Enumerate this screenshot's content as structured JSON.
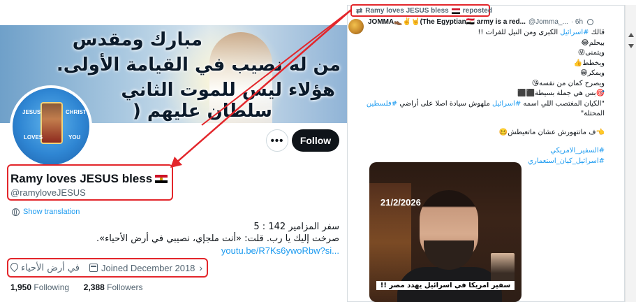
{
  "profile": {
    "banner_lines": [
      "مبارك ومقدس",
      "من له نصيب في القيامة الأولى.",
      "هؤلاء ليس للموت الثاني",
      "سلطان عليهم ("
    ],
    "avatar_text": {
      "left": "JESUS",
      "right": "CHRIST",
      "bottom_left": "LOVES",
      "bottom_right": "YOU"
    },
    "more_label": "•••",
    "follow_label": "Follow",
    "display_name": "Ramy loves JESUS bless",
    "handle": "@ramyloveJESUS",
    "show_translation": "Show translation",
    "bio": {
      "line1": "سفر المزامير 142 : 5",
      "line2": "صرخت إليك يا رب. قلت: «أنت ملجإي، نصيبي في أرض الأحياء».",
      "link": "youtu.be/R7Ks6ywoRbw?si..."
    },
    "location": "في أرض الأحياء",
    "joined": "Joined December 2018",
    "following_count": "1,950",
    "following_label": "Following",
    "followers_count": "2,388",
    "followers_label": "Followers"
  },
  "tweet": {
    "repost_by": "Ramy loves JESUS bless",
    "repost_label": "reposted",
    "author_name": "JOMMA👞✌️🤘(The Egyptian🇪🇬 army is a red...",
    "author_handle": "@Jomma_...",
    "time": "· 6h",
    "body_lines": [
      "قالك #اسرائيل الكبرى ومن النيل للفرات !!",
      "بيحلم😂",
      "ويتمنى😜",
      "ويخطط👍",
      "ويمكر😁",
      "ويصرح كمان من نفسه😘",
      "🎯بس هي جملة بسيطة⬛⬛",
      "\"الكيان المغتصب اللي اسمه #اسرائيل ملهوش سيادة اصلا على أراضي #فلسطين",
      "المحتلة\"",
      "",
      "👈ف ماتتهورش عشان ماتعيطش🥴",
      "",
      "#السفير_الامريكي",
      "#اسرائيل_كيان_استعماري"
    ],
    "video_date": "21/2/2026",
    "video_caption": "سفير امريكا في اسرائيل يهدد مصر !!"
  },
  "colors": {
    "accent": "#1d9bf0",
    "highlight": "#e3262b",
    "text_primary": "#0f1419",
    "text_secondary": "#536471"
  }
}
